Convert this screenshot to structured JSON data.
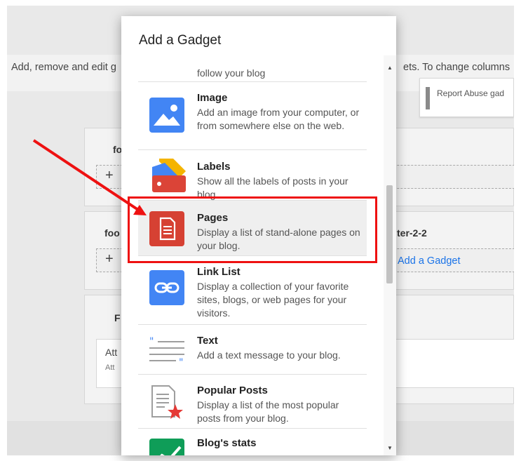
{
  "background": {
    "instructions_left": "Add, remove and edit g",
    "instructions_right": "ets. To change columns",
    "report_abuse": "Report Abuse gad",
    "sections": [
      {
        "label": "fo"
      },
      {
        "label": "foo"
      },
      {
        "label": "ter-2-2"
      },
      {
        "label": "F"
      }
    ],
    "add_gadget_link": "Add a Gadget",
    "attribution_title": "Att",
    "attribution_sub": "Att"
  },
  "modal": {
    "title": "Add a Gadget",
    "items": [
      {
        "name": "",
        "desc": "follow your blog",
        "icon": "blank-icon"
      },
      {
        "name": "Image",
        "desc": "Add an image from your computer, or from somewhere else on the web.",
        "icon": "image-icon"
      },
      {
        "name": "Labels",
        "desc": "Show all the labels of posts in your blog",
        "icon": "label-tag-icon"
      },
      {
        "name": "Pages",
        "desc": "Display a list of stand-alone pages on your blog.",
        "icon": "pages-document-icon"
      },
      {
        "name": "Link List",
        "desc": "Display a collection of your favorite sites, blogs, or web pages for your visitors.",
        "icon": "link-icon"
      },
      {
        "name": "Text",
        "desc": "Add a text message to your blog.",
        "icon": "text-quote-icon"
      },
      {
        "name": "Popular Posts",
        "desc": "Display a list of the most popular posts from your blog.",
        "icon": "popular-posts-icon"
      },
      {
        "name": "Blog's stats",
        "desc": "",
        "icon": "stats-chart-icon"
      }
    ]
  },
  "colors": {
    "accent_blue": "#4285f4",
    "link_blue": "#1a73e8",
    "pages_red": "#d64133",
    "labels_yellow": "#f4b400",
    "stats_green": "#0f9d58",
    "highlight_red": "#ee1111"
  }
}
